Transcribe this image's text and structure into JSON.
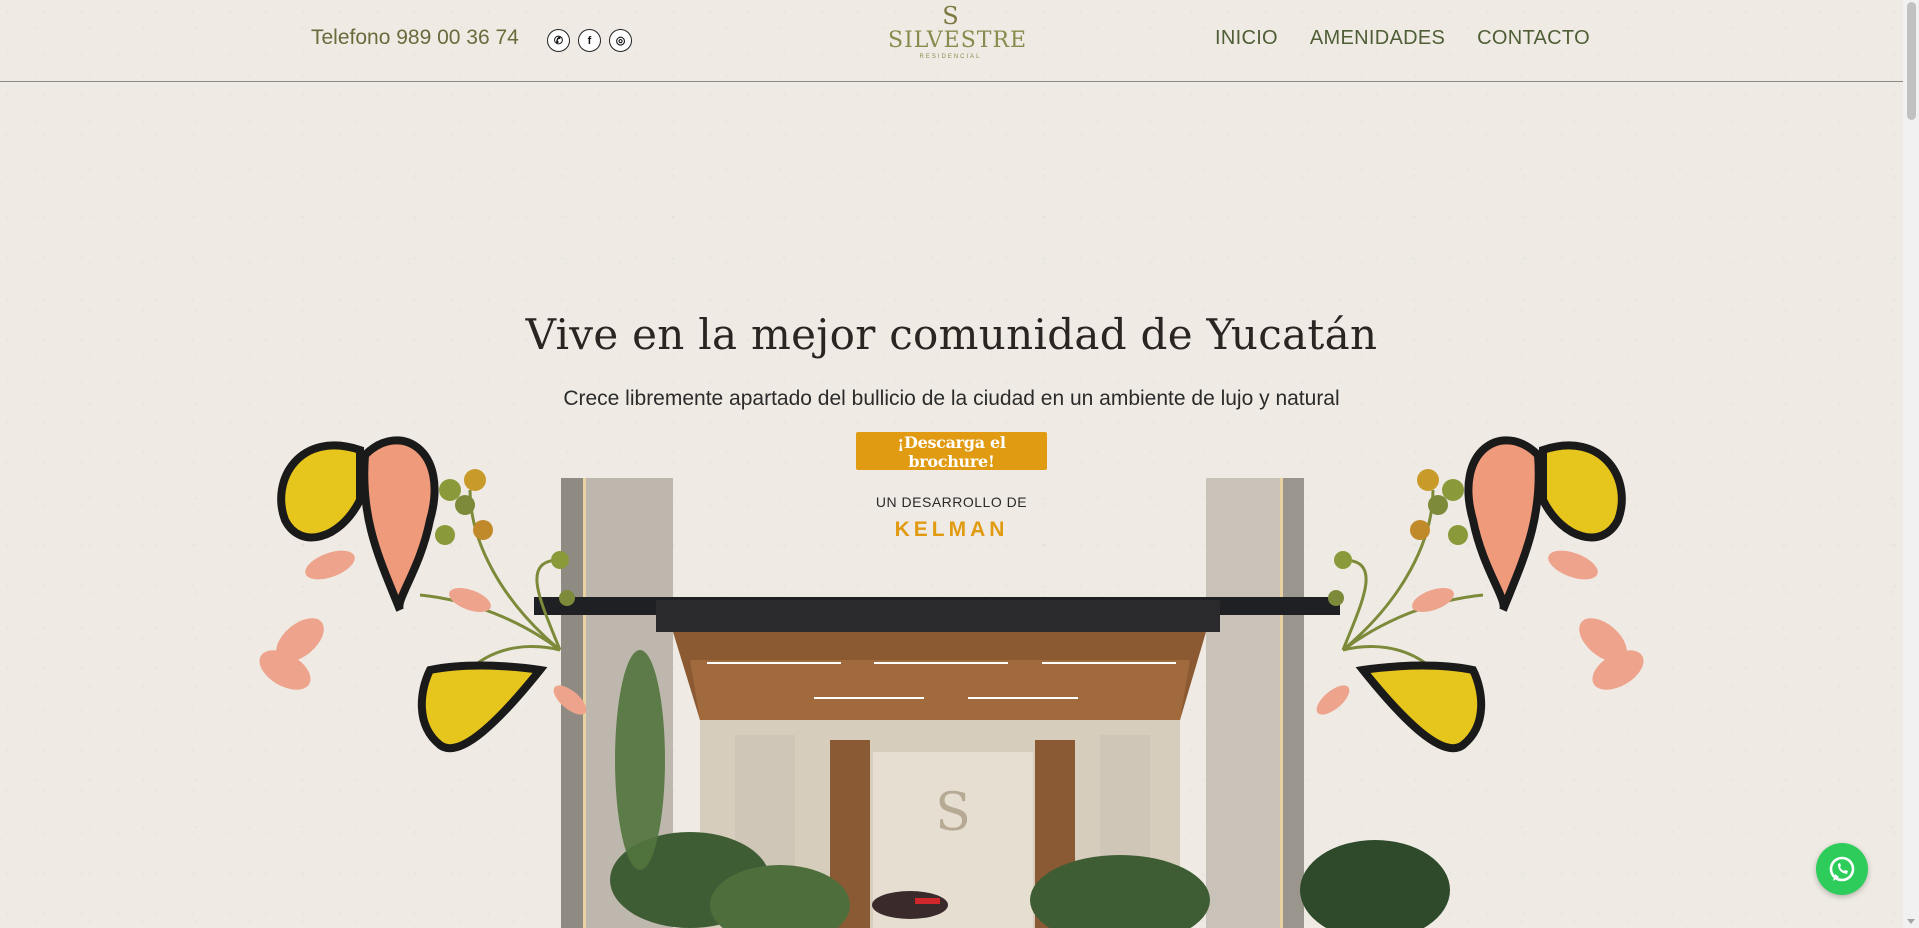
{
  "header": {
    "phone": "Telefono 989 00 36 74",
    "social": [
      {
        "name": "whatsapp-icon",
        "glyph": "✆"
      },
      {
        "name": "facebook-icon",
        "glyph": "f"
      },
      {
        "name": "instagram-icon",
        "glyph": "◎"
      }
    ],
    "logo": {
      "mark": "S",
      "name": "SILVESTRE",
      "sub": "RESIDENCIAL"
    },
    "nav": [
      "INICIO",
      "AMENIDADES",
      "CONTACTO"
    ]
  },
  "hero": {
    "title": "Vive en la mejor comunidad de Yucatán",
    "subtitle": "Crece libremente apartado del bullicio de la ciudad en un ambiente de lujo y natural",
    "cta": "¡Descarga el brochure!",
    "developer_label": "UN DESARROLLO DE",
    "developer_name": "KELMAN"
  },
  "colors": {
    "background": "#efebe4",
    "accent": "#e19b13",
    "nav": "#4f5e36",
    "whatsapp": "#2ecc5b"
  }
}
